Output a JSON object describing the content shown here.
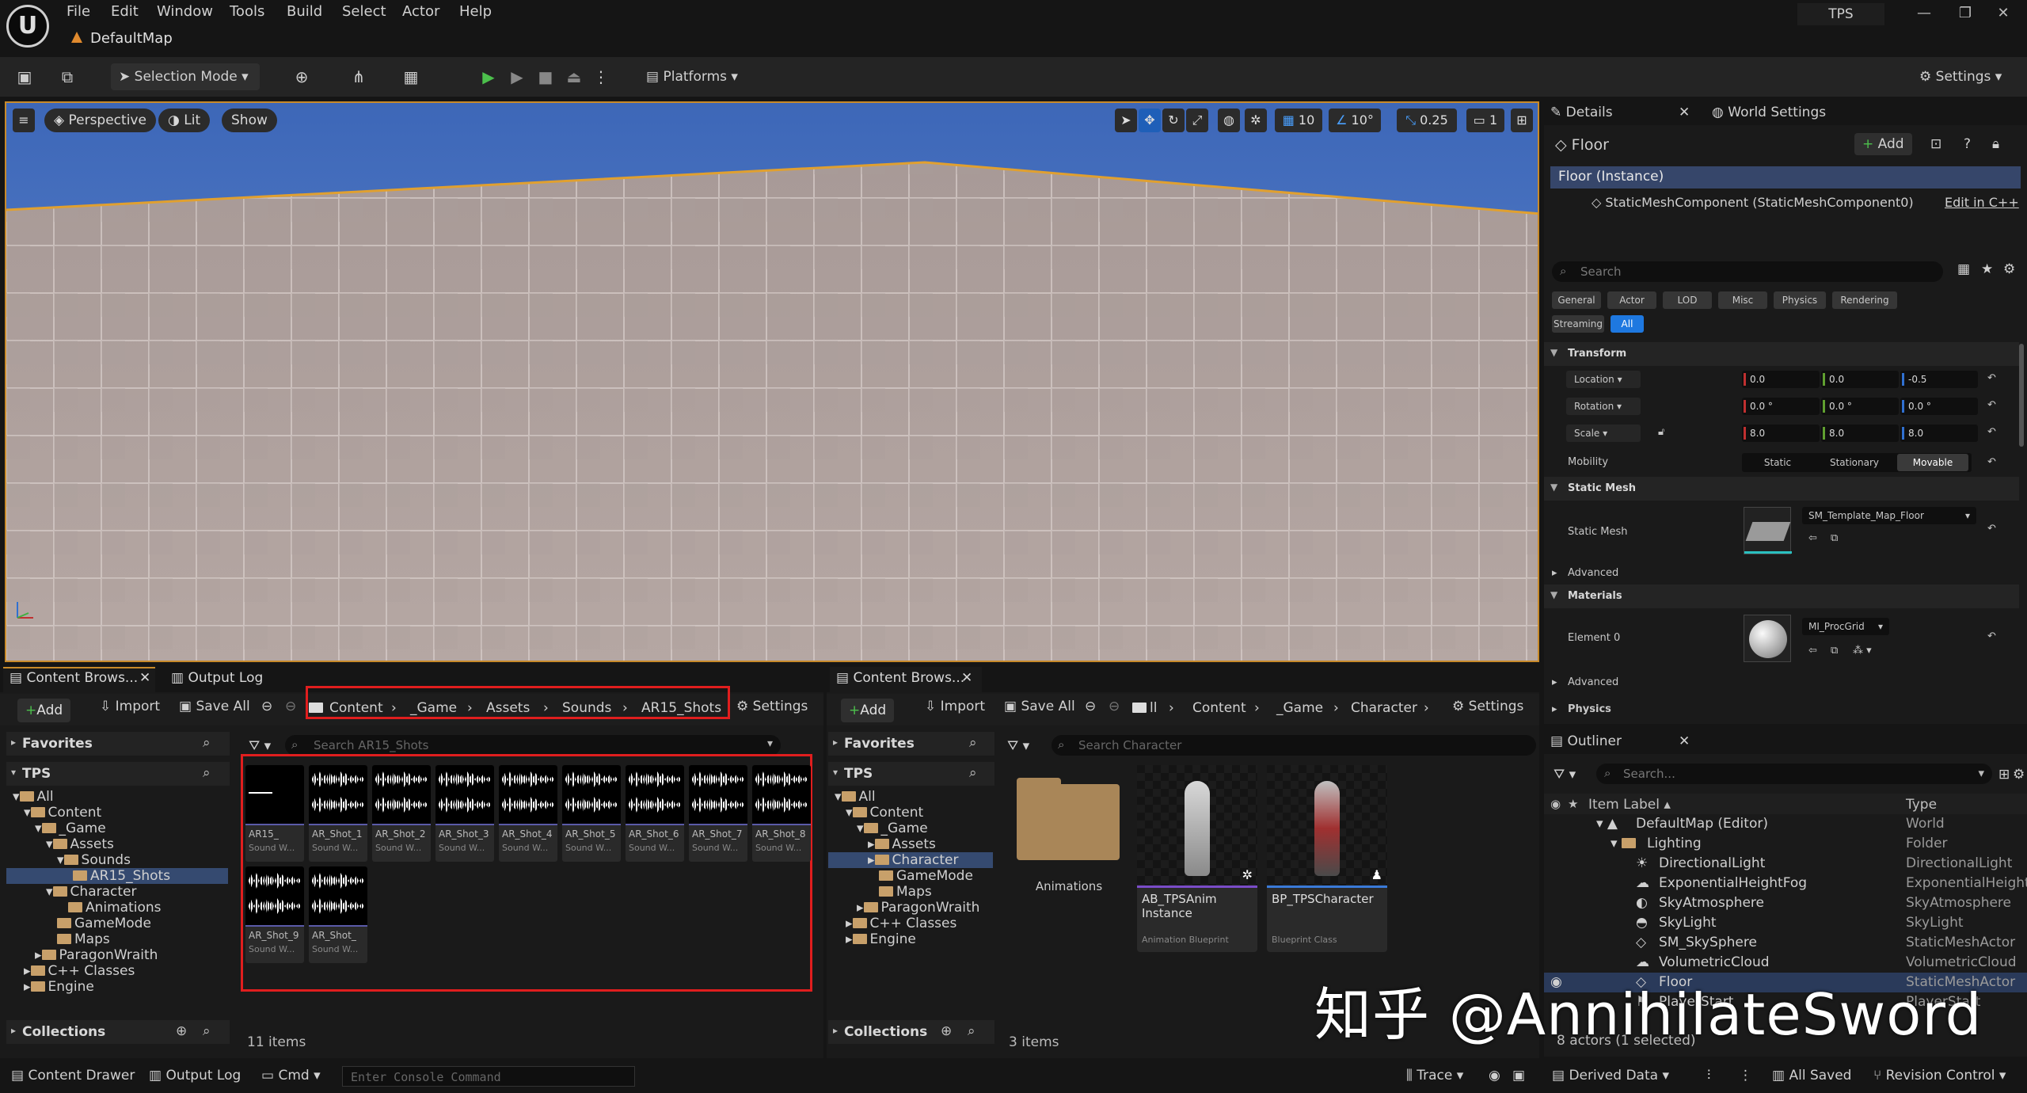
{
  "menu": {
    "items": [
      "File",
      "Edit",
      "Window",
      "Tools",
      "Build",
      "Select",
      "Actor",
      "Help"
    ],
    "map_tab": "DefaultMap",
    "project": "TPS"
  },
  "toolbar": {
    "selection_mode": "Selection Mode",
    "platforms": "Platforms",
    "settings": "Settings"
  },
  "viewport": {
    "perspective": "Perspective",
    "lit": "Lit",
    "show": "Show",
    "grid_snap": "10",
    "rot_snap": "10°",
    "scale_snap": "0.25",
    "camera_speed": "1"
  },
  "details": {
    "tab": "Details",
    "tab2": "World Settings",
    "actor_name": "Floor",
    "add_label": "Add",
    "instance": "Floor (Instance)",
    "component": "StaticMeshComponent (StaticMeshComponent0)",
    "edit_cpp": "Edit in C++",
    "search_placeholder": "Search",
    "filters": [
      "General",
      "Actor",
      "LOD",
      "Misc",
      "Physics",
      "Rendering",
      "Streaming",
      "All"
    ],
    "transform": {
      "header": "Transform",
      "location": {
        "label": "Location",
        "x": "0.0",
        "y": "0.0",
        "z": "-0.5"
      },
      "rotation": {
        "label": "Rotation",
        "x": "0.0 °",
        "y": "0.0 °",
        "z": "0.0 °"
      },
      "scale": {
        "label": "Scale",
        "x": "8.0",
        "y": "8.0",
        "z": "8.0"
      },
      "mobility": {
        "label": "Mobility",
        "options": [
          "Static",
          "Stationary",
          "Movable"
        ],
        "selected": "Movable"
      }
    },
    "static_mesh": {
      "header": "Static Mesh",
      "label": "Static Mesh",
      "value": "SM_Template_Map_Floor"
    },
    "advanced": "Advanced",
    "materials": {
      "header": "Materials",
      "label": "Element 0",
      "value": "MI_ProcGrid"
    },
    "physics": "Physics"
  },
  "outliner": {
    "tab": "Outliner",
    "search_placeholder": "Search...",
    "col_label": "Item Label",
    "col_type": "Type",
    "rows": [
      {
        "label": "DefaultMap (Editor)",
        "type": "World"
      },
      {
        "label": "Lighting",
        "type": "Folder"
      },
      {
        "label": "DirectionalLight",
        "type": "DirectionalLight"
      },
      {
        "label": "ExponentialHeightFog",
        "type": "ExponentialHeightF"
      },
      {
        "label": "SkyAtmosphere",
        "type": "SkyAtmosphere"
      },
      {
        "label": "SkyLight",
        "type": "SkyLight"
      },
      {
        "label": "SM_SkySphere",
        "type": "StaticMeshActor"
      },
      {
        "label": "VolumetricCloud",
        "type": "VolumetricCloud"
      },
      {
        "label": "Floor",
        "type": "StaticMeshActor"
      },
      {
        "label": "PlayerStart",
        "type": "PlayerStart"
      }
    ],
    "footer": "8 actors (1 selected)"
  },
  "cb1": {
    "tab": "Content Brows...",
    "tab2": "Output Log",
    "add": "Add",
    "import": "Import",
    "save_all": "Save All",
    "settings": "Settings",
    "breadcrumbs": [
      "Content",
      "_Game",
      "Assets",
      "Sounds",
      "AR15_Shots"
    ],
    "search_placeholder": "Search AR15_Shots",
    "favorites": "Favorites",
    "tps": "TPS",
    "collections": "Collections",
    "tree": [
      "All",
      "Content",
      "_Game",
      "Assets",
      "Sounds",
      "AR15_Shots",
      "Character",
      "Animations",
      "GameMode",
      "Maps",
      "ParagonWraith",
      "C++ Classes",
      "Engine"
    ],
    "assets": [
      {
        "name": "AR15_",
        "type": "Sound W..."
      },
      {
        "name": "AR_Shot_1",
        "type": "Sound W..."
      },
      {
        "name": "AR_Shot_2",
        "type": "Sound W..."
      },
      {
        "name": "AR_Shot_3",
        "type": "Sound W..."
      },
      {
        "name": "AR_Shot_4",
        "type": "Sound W..."
      },
      {
        "name": "AR_Shot_5",
        "type": "Sound W..."
      },
      {
        "name": "AR_Shot_6",
        "type": "Sound W..."
      },
      {
        "name": "AR_Shot_7",
        "type": "Sound W..."
      },
      {
        "name": "AR_Shot_8",
        "type": "Sound W..."
      },
      {
        "name": "AR_Shot_9",
        "type": "Sound W..."
      },
      {
        "name": "AR_Shot_",
        "type": "Sound W..."
      }
    ],
    "item_count": "11 items"
  },
  "cb2": {
    "tab": "Content Brows...",
    "add": "Add",
    "import": "Import",
    "save_all": "Save All",
    "settings": "Settings",
    "breadcrumbs": [
      "Content",
      "_Game",
      "Character"
    ],
    "search_placeholder": "Search Character",
    "favorites": "Favorites",
    "tps": "TPS",
    "collections": "Collections",
    "tree": [
      "All",
      "Content",
      "_Game",
      "Assets",
      "Character",
      "GameMode",
      "Maps",
      "ParagonWraith",
      "C++ Classes",
      "Engine"
    ],
    "assets": [
      {
        "name": "Animations",
        "type": ""
      },
      {
        "name": "AB_TPSAnim Instance",
        "type": "Animation Blueprint"
      },
      {
        "name": "BP_TPSCharacter",
        "type": "Blueprint Class"
      }
    ],
    "item_count": "3 items"
  },
  "statusbar": {
    "content_drawer": "Content Drawer",
    "output_log": "Output Log",
    "cmd": "Cmd",
    "console_placeholder": "Enter Console Command",
    "trace": "Trace",
    "derived_data": "Derived Data",
    "all_saved": "All Saved",
    "revision": "Revision Control"
  },
  "watermark": "知乎 @AnnihilateSword"
}
